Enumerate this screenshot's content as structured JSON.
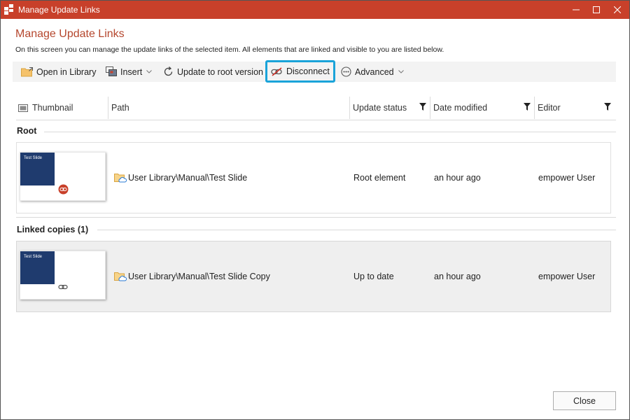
{
  "window": {
    "title": "Manage Update Links",
    "accent_color": "#c8402a",
    "controls": [
      "minimize-icon",
      "maximize-icon",
      "close-icon"
    ]
  },
  "header": {
    "title": "Manage Update Links",
    "description": "On this screen you can manage the update links of the selected item. All elements that are linked and visible to you are listed below."
  },
  "toolbar": {
    "open_library": {
      "label": "Open in Library",
      "icon": "folder-open-icon"
    },
    "insert": {
      "label": "Insert",
      "icon": "insert-slide-icon",
      "has_dropdown": true
    },
    "update_root": {
      "label": "Update to root version",
      "icon": "refresh-icon"
    },
    "disconnect": {
      "label": "Disconnect",
      "icon": "unlink-icon",
      "highlighted": true,
      "highlight_color": "#1aa3d9"
    },
    "advanced": {
      "label": "Advanced",
      "icon": "more-icon",
      "has_dropdown": true
    }
  },
  "columns": {
    "thumbnail": "Thumbnail",
    "path": "Path",
    "update_status": "Update status",
    "date_modified": "Date modified",
    "editor": "Editor"
  },
  "groups": {
    "root": {
      "label": "Root",
      "row": {
        "thumb_text": "Test Slide",
        "thumb_badge": "root-link-icon",
        "path": "User Library\\Manual\\Test Slide",
        "status": "Root element",
        "date": "an hour ago",
        "editor": "empower User"
      }
    },
    "linked": {
      "label": "Linked copies (1)",
      "row": {
        "thumb_text": "Test Slide",
        "thumb_badge": "link-icon",
        "path": "User Library\\Manual\\Test Slide Copy",
        "status": "Up to date",
        "date": "an hour ago",
        "editor": "empower User",
        "selected": true
      }
    }
  },
  "footer": {
    "close_label": "Close"
  }
}
